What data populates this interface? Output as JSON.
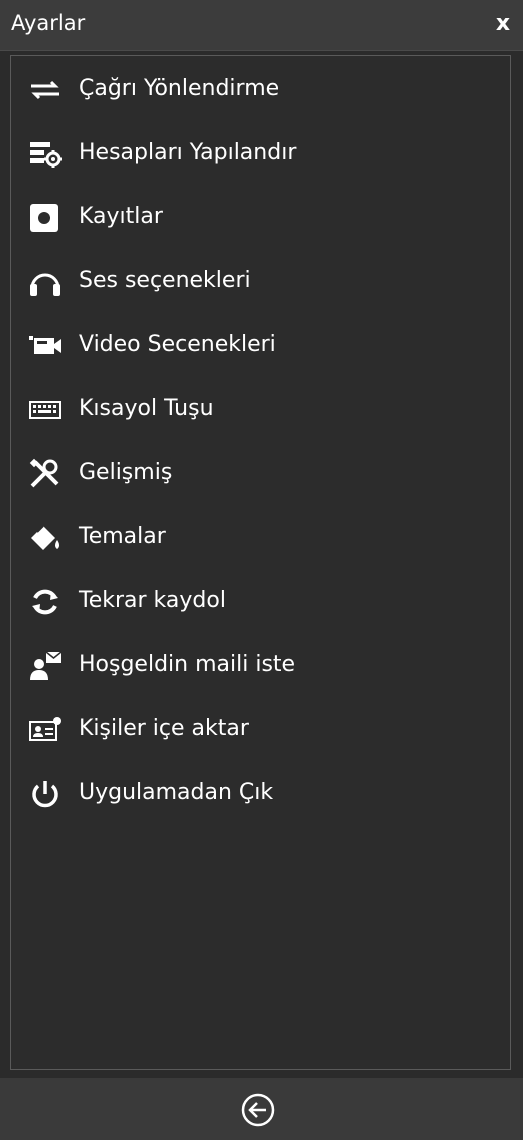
{
  "window": {
    "title": "Ayarlar",
    "close_label": "x"
  },
  "menu": {
    "items": [
      {
        "label": "Çağrı Yönlendirme",
        "icon": "call-forward-icon"
      },
      {
        "label": "Hesapları Yapılandır",
        "icon": "account-settings-icon"
      },
      {
        "label": "Kayıtlar",
        "icon": "record-icon"
      },
      {
        "label": "Ses seçenekleri",
        "icon": "headphones-icon"
      },
      {
        "label": "Video Secenekleri",
        "icon": "video-camera-icon"
      },
      {
        "label": "Kısayol Tuşu",
        "icon": "keyboard-icon"
      },
      {
        "label": "Gelişmiş",
        "icon": "tools-icon"
      },
      {
        "label": "Temalar",
        "icon": "paint-bucket-icon"
      },
      {
        "label": "Tekrar kaydol",
        "icon": "refresh-icon"
      },
      {
        "label": "Hoşgeldin maili iste",
        "icon": "user-mail-icon"
      },
      {
        "label": "Kişiler içe aktar",
        "icon": "contacts-import-icon"
      },
      {
        "label": "Uygulamadan Çık",
        "icon": "power-icon"
      }
    ]
  },
  "footer": {
    "back_icon": "back-arrow-icon"
  },
  "colors": {
    "background": "#2b2b2b",
    "titlebar": "#3c3c3c",
    "panel_border": "#5a5a5a",
    "text": "#ffffff"
  }
}
